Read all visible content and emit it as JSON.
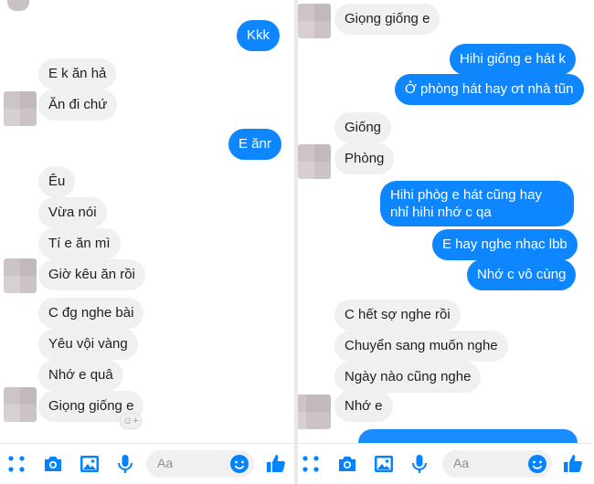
{
  "left": {
    "messages": [
      {
        "id": "kkk",
        "text": "Kkk"
      },
      {
        "id": "e-k-an-ha",
        "text": "E k ăn hả"
      },
      {
        "id": "an-di-chu",
        "text": "Ăn đi chứ"
      },
      {
        "id": "e-anr",
        "text": "E ănr"
      },
      {
        "id": "eu",
        "text": "Êu"
      },
      {
        "id": "vua-noi",
        "text": "Vừa nói"
      },
      {
        "id": "ti-e-an-mi",
        "text": "Tí e ăn mì"
      },
      {
        "id": "gio-keu-an-roi",
        "text": "Giờ kêu ăn rồi"
      },
      {
        "id": "c-dg-nghe-bai",
        "text": "C đg nghe bài"
      },
      {
        "id": "yeu-voi-vang",
        "text": "Yêu vội vàng"
      },
      {
        "id": "nho-e-qua",
        "text": "Nhớ e quâ"
      },
      {
        "id": "giong-giong-e-left",
        "text": "Giọng giống e"
      }
    ],
    "reaction_symbol": "☺+",
    "composer_placeholder": "Aa"
  },
  "right": {
    "messages": [
      {
        "id": "giong-giong-e-right",
        "text": "Giọng giống e"
      },
      {
        "id": "hihi-giong-e-hat-k",
        "text": "Hihi giống e hát k"
      },
      {
        "id": "o-phong-hat-hay",
        "text": "Ở phòng hát hay ơt nhà tũn"
      },
      {
        "id": "giong",
        "text": "Giống"
      },
      {
        "id": "phong",
        "text": "Phòng"
      },
      {
        "id": "hihi-phog-e-hat",
        "text": "Hihi phòg e hát cũng hay nhỉ hihi nhớ c qa"
      },
      {
        "id": "e-hay-nghe-nhac",
        "text": "E hay nghe nhạc lbb"
      },
      {
        "id": "nho-c-vo-cung",
        "text": "Nhớ c vô cùng"
      },
      {
        "id": "c-het-so-nghe-roi",
        "text": "C hết sợ nghe rồi"
      },
      {
        "id": "chuyen-sang-muon-nghe",
        "text": "Chuyển sang muốn nghe"
      },
      {
        "id": "ngay-nao-cung-nghe",
        "text": "Ngày nào cũng nghe"
      },
      {
        "id": "nho-e",
        "text": "Nhớ e"
      }
    ],
    "composer_placeholder": "Aa"
  },
  "colors": {
    "outgoing_bubble": "#0d86ff",
    "incoming_bubble": "#f1f0f0",
    "toolbar_icon": "#0084ff"
  },
  "icons": [
    "grid-dots-icon",
    "camera-icon",
    "image-icon",
    "microphone-icon",
    "emoji-icon",
    "thumbs-up-icon"
  ]
}
